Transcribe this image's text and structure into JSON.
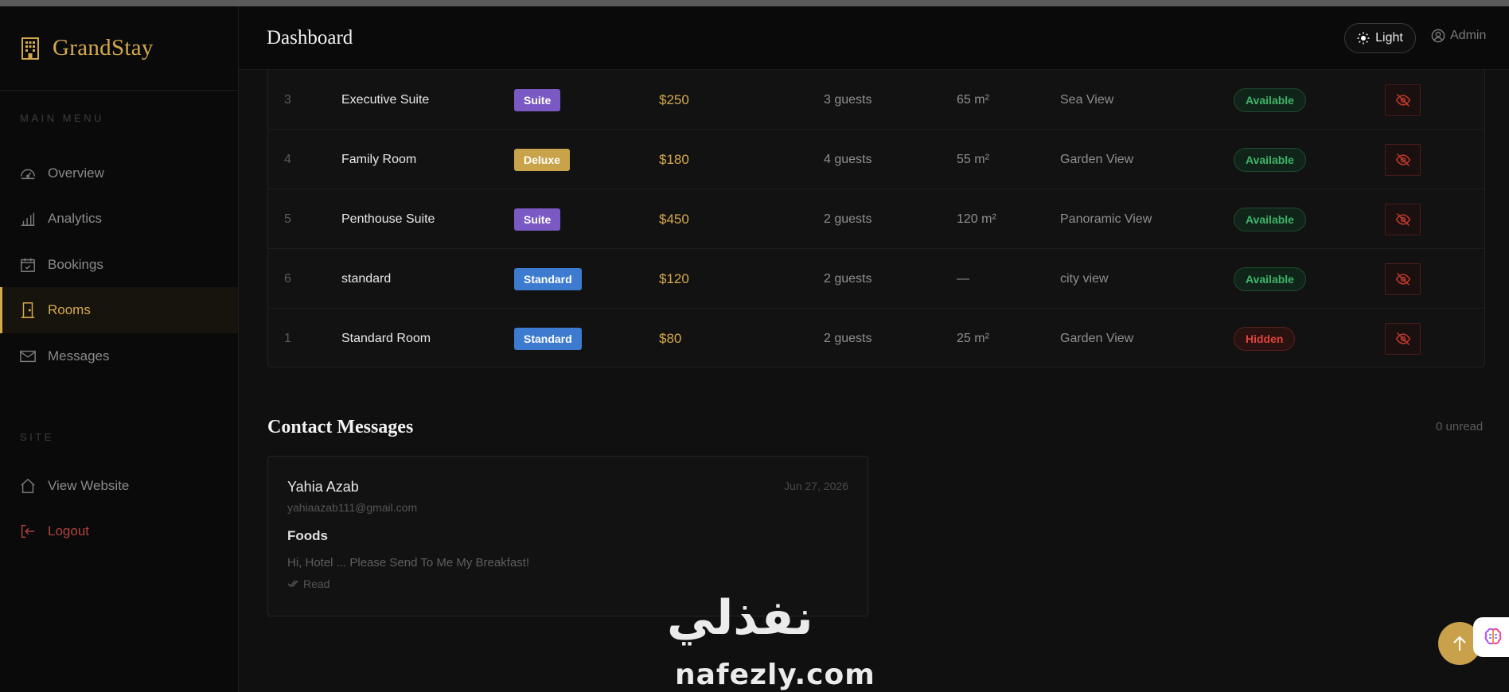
{
  "brand": {
    "name": "GrandStay"
  },
  "sidebar": {
    "main_label": "MAIN MENU",
    "site_label": "SITE",
    "items": [
      {
        "label": "Overview",
        "icon": "gauge-icon"
      },
      {
        "label": "Analytics",
        "icon": "bar-chart-icon"
      },
      {
        "label": "Bookings",
        "icon": "calendar-check-icon"
      },
      {
        "label": "Rooms",
        "icon": "door-icon",
        "active": true
      },
      {
        "label": "Messages",
        "icon": "envelope-icon"
      }
    ],
    "site_items": [
      {
        "label": "View Website",
        "icon": "home-icon"
      },
      {
        "label": "Logout",
        "icon": "logout-icon"
      }
    ]
  },
  "header": {
    "title": "Dashboard",
    "theme_label": "Light",
    "user_label": "Admin"
  },
  "rooms": [
    {
      "id": "3",
      "name": "Executive Suite",
      "type": "Suite",
      "type_color": "#7b59c4",
      "price": "$250",
      "guests": "3 guests",
      "size": "65 m²",
      "view": "Sea View",
      "status": "Available"
    },
    {
      "id": "4",
      "name": "Family Room",
      "type": "Deluxe",
      "type_color": "#c9a34a",
      "price": "$180",
      "guests": "4 guests",
      "size": "55 m²",
      "view": "Garden View",
      "status": "Available"
    },
    {
      "id": "5",
      "name": "Penthouse Suite",
      "type": "Suite",
      "type_color": "#7b59c4",
      "price": "$450",
      "guests": "2 guests",
      "size": "120 m²",
      "view": "Panoramic View",
      "status": "Available"
    },
    {
      "id": "6",
      "name": "standard",
      "type": "Standard",
      "type_color": "#3d7bd1",
      "price": "$120",
      "guests": "2 guests",
      "size": "—",
      "view": "city view",
      "status": "Available"
    },
    {
      "id": "1",
      "name": "Standard Room",
      "type": "Standard",
      "type_color": "#3d7bd1",
      "price": "$80",
      "guests": "2 guests",
      "size": "25 m²",
      "view": "Garden View",
      "status": "Hidden"
    }
  ],
  "colors": {
    "accent": "#d4a94c",
    "available_text": "#3fb56a",
    "available_bg": "#102419",
    "available_border": "#1f4a2d",
    "hidden_text": "#e0443a",
    "hidden_bg": "#2a1211",
    "hidden_border": "#5a1f1c"
  },
  "contact": {
    "title": "Contact Messages",
    "unread": "0 unread",
    "message": {
      "name": "Yahia Azab",
      "email": "yahiaazab111@gmail.com",
      "date": "Jun 27, 2026",
      "subject": "Foods",
      "body": "Hi, Hotel ... Please Send To Me My Breakfast!",
      "status": "Read"
    }
  },
  "watermark": {
    "arabic": "نفذلي",
    "latin": "nafezly.com"
  }
}
